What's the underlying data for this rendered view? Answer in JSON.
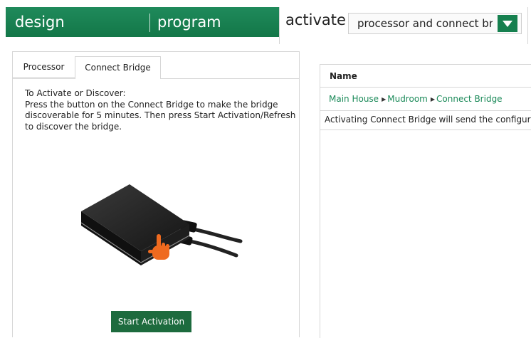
{
  "nav": {
    "design": "design",
    "program": "program",
    "activate": "activate",
    "mode_select_value": "processor and connect bridge"
  },
  "subtabs": [
    "Processor",
    "Connect Bridge"
  ],
  "instructions": {
    "heading": "To Activate or Discover:",
    "body": "Press the button on the Connect Bridge to make the bridge discoverable for 5 minutes. Then press Start Activation/Refresh to discover the bridge."
  },
  "start_button": "Start Activation",
  "table": {
    "column_header": "Name",
    "breadcrumb": [
      "Main House",
      "Mudroom",
      "Connect Bridge"
    ],
    "status": "Activating Connect Bridge will send the configuration"
  },
  "colors": {
    "nav_green": "#16804f",
    "button_green": "#1d6b3e",
    "link_green": "#1b8a59",
    "hand_orange": "#ef6a1f"
  },
  "icons": {
    "dropdown": "triangle-down-icon",
    "breadcrumb_separator": "triangle-right-icon",
    "pointer": "pointing-hand-icon"
  }
}
